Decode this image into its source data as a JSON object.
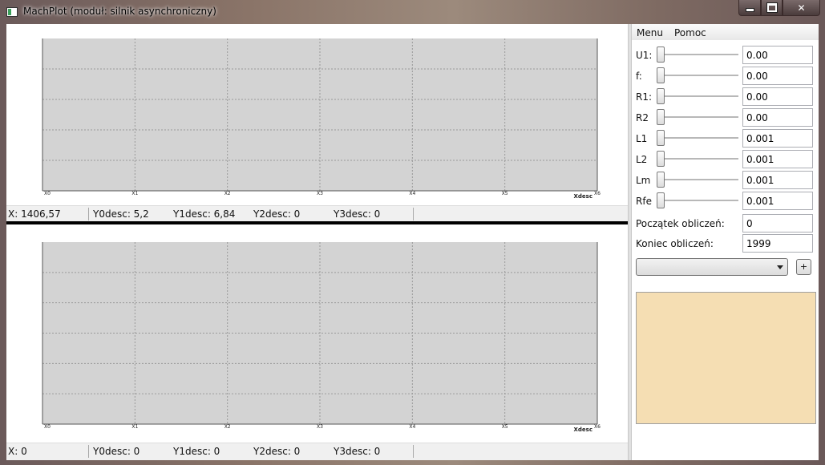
{
  "window": {
    "title": "MachPlot (moduł: silnik asynchroniczny)",
    "minimize_glyph": "minimize-icon",
    "maximize_glyph": "maximize-icon",
    "close_glyph": "✕"
  },
  "plots": [
    {
      "x_ticks": [
        "X0",
        "X1",
        "X2",
        "X3",
        "X4",
        "X5",
        "X6"
      ],
      "x_label": "Xdesc",
      "status": {
        "x": "X: 1406,57",
        "y0": "Y0desc: 5,2",
        "y1": "Y1desc: 6,84",
        "y2": "Y2desc: 0",
        "y3": "Y3desc: 0"
      }
    },
    {
      "x_ticks": [
        "X0",
        "X1",
        "X2",
        "X3",
        "X4",
        "X5",
        "X6"
      ],
      "x_label": "Xdesc",
      "status": {
        "x": "X: 0",
        "y0": "Y0desc: 0",
        "y1": "Y1desc: 0",
        "y2": "Y2desc: 0",
        "y3": "Y3desc: 0"
      }
    }
  ],
  "menu": {
    "menu_label": "Menu",
    "help_label": "Pomoc"
  },
  "params": [
    {
      "label": "U1:",
      "value": "0.00"
    },
    {
      "label": "f:",
      "value": "0.00"
    },
    {
      "label": "R1:",
      "value": "0.00"
    },
    {
      "label": "R2",
      "value": "0.00"
    },
    {
      "label": "L1",
      "value": "0.001"
    },
    {
      "label": "L2",
      "value": "0.001"
    },
    {
      "label": "Lm",
      "value": "0.001"
    },
    {
      "label": "Rfe",
      "value": "0.001"
    }
  ],
  "calc": {
    "start_label": "Początek obliczeń:",
    "start_value": "0",
    "end_label": "Koniec obliczeń:",
    "end_value": "1999"
  },
  "combo": {
    "selected": ""
  },
  "add_button_label": "+",
  "colors": {
    "plot_area": "#d3d3d3",
    "info_area": "#f5deb3",
    "splitter": "#000000"
  }
}
